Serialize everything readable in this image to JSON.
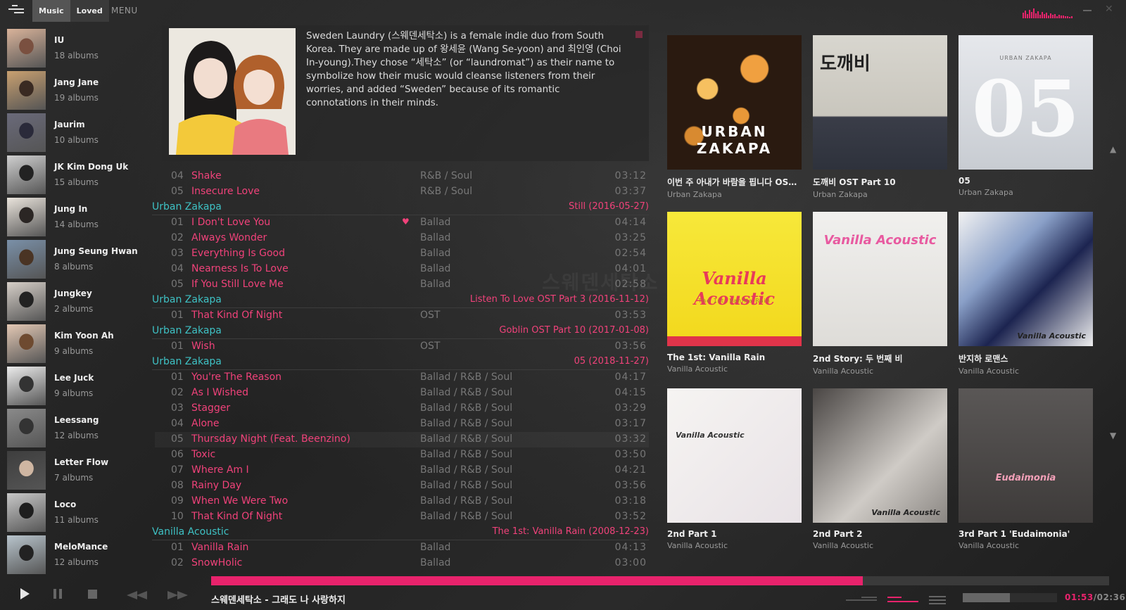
{
  "topbar": {
    "tabs": [
      "Music",
      "Loved"
    ],
    "menu_label": "MENU"
  },
  "artists": [
    {
      "name": "IU",
      "albums": "18 albums"
    },
    {
      "name": "Jang Jane",
      "albums": "19 albums"
    },
    {
      "name": "Jaurim",
      "albums": "10 albums"
    },
    {
      "name": "JK Kim Dong Uk",
      "albums": "15 albums"
    },
    {
      "name": "Jung In",
      "albums": "14 albums"
    },
    {
      "name": "Jung Seung Hwan",
      "albums": "8 albums"
    },
    {
      "name": "Jungkey",
      "albums": "2 albums"
    },
    {
      "name": "Kim Yoon Ah",
      "albums": "9 albums"
    },
    {
      "name": "Lee Juck",
      "albums": "9 albums"
    },
    {
      "name": "Leessang",
      "albums": "12 albums"
    },
    {
      "name": "Letter Flow",
      "albums": "7 albums"
    },
    {
      "name": "Loco",
      "albums": "11 albums"
    },
    {
      "name": "MeloMance",
      "albums": "12 albums"
    }
  ],
  "artist_info": {
    "bio": "Sweden Laundry (스웨덴세탁소) is a female indie duo from South Korea. They are made up of 왕세윤 (Wang Se-yoon) and 최인영 (Choi In-young).They chose “세탁소” (or “laundromat”) as their name to symbolize how their music would cleanse listeners from their worries, and added “Sweden” because of its romantic connotations in their minds."
  },
  "tracklist": {
    "pre_tracks": [
      {
        "no": "04",
        "title": "Shake",
        "genre": "R&B / Soul",
        "duration": "03:12"
      },
      {
        "no": "05",
        "title": "Insecure Love",
        "genre": "R&B / Soul",
        "duration": "03:37"
      }
    ],
    "groups": [
      {
        "artist": "Urban Zakapa",
        "album": "Still (2016-05-27)",
        "tracks": [
          {
            "no": "01",
            "title": "I Don't Love You",
            "genre": "Ballad",
            "duration": "04:14",
            "loved": true
          },
          {
            "no": "02",
            "title": "Always Wonder",
            "genre": "Ballad",
            "duration": "03:25"
          },
          {
            "no": "03",
            "title": "Everything Is Good",
            "genre": "Ballad",
            "duration": "02:54"
          },
          {
            "no": "04",
            "title": "Nearness Is To Love",
            "genre": "Ballad",
            "duration": "04:01"
          },
          {
            "no": "05",
            "title": "If You Still Love Me",
            "genre": "Ballad",
            "duration": "02:58"
          }
        ]
      },
      {
        "artist": "Urban Zakapa",
        "album": "Listen To Love OST Part 3 (2016-11-12)",
        "tracks": [
          {
            "no": "01",
            "title": "That Kind Of Night",
            "genre": "OST",
            "duration": "03:53"
          }
        ]
      },
      {
        "artist": "Urban Zakapa",
        "album": "Goblin OST Part 10 (2017-01-08)",
        "tracks": [
          {
            "no": "01",
            "title": "Wish",
            "genre": "OST",
            "duration": "03:56"
          }
        ]
      },
      {
        "artist": "Urban Zakapa",
        "album": "05 (2018-11-27)",
        "tracks": [
          {
            "no": "01",
            "title": "You're The Reason",
            "genre": "Ballad / R&B / Soul",
            "duration": "04:17"
          },
          {
            "no": "02",
            "title": "As I Wished",
            "genre": "Ballad / R&B / Soul",
            "duration": "04:15"
          },
          {
            "no": "03",
            "title": "Stagger",
            "genre": "Ballad / R&B / Soul",
            "duration": "03:29"
          },
          {
            "no": "04",
            "title": "Alone",
            "genre": "Ballad / R&B / Soul",
            "duration": "03:17"
          },
          {
            "no": "05",
            "title": "Thursday Night (Feat. Beenzino)",
            "genre": "Ballad / R&B / Soul",
            "duration": "03:32",
            "highlight": true
          },
          {
            "no": "06",
            "title": "Toxic",
            "genre": "Ballad / R&B / Soul",
            "duration": "03:50"
          },
          {
            "no": "07",
            "title": "Where Am I",
            "genre": "Ballad / R&B / Soul",
            "duration": "04:21"
          },
          {
            "no": "08",
            "title": "Rainy Day",
            "genre": "Ballad / R&B / Soul",
            "duration": "03:56"
          },
          {
            "no": "09",
            "title": "When We Were Two",
            "genre": "Ballad / R&B / Soul",
            "duration": "03:18"
          },
          {
            "no": "10",
            "title": "That Kind Of Night",
            "genre": "Ballad / R&B / Soul",
            "duration": "03:52"
          }
        ]
      },
      {
        "artist": "Vanilla Acoustic",
        "album": "The 1st: Vanilla Rain (2008-12-23)",
        "tracks": [
          {
            "no": "01",
            "title": "Vanilla Rain",
            "genre": "Ballad",
            "duration": "04:13"
          },
          {
            "no": "02",
            "title": "SnowHolic",
            "genre": "Ballad",
            "duration": "03:00"
          }
        ]
      }
    ]
  },
  "albums": [
    {
      "title": "이번 주 아내가 바람을 핍니다 OST P...",
      "artist": "Urban Zakapa",
      "cover_text": "URBAN ZAKAPA"
    },
    {
      "title": "도깨비 OST Part 10",
      "artist": "Urban Zakapa",
      "cover_text": "도깨비"
    },
    {
      "title": "05",
      "artist": "Urban Zakapa",
      "cover_text": "05",
      "cover_small": "URBAN ZAKAPA"
    },
    {
      "title": "The 1st: Vanilla Rain",
      "artist": "Vanilla Acoustic",
      "cover_text": "Vanilla Acoustic",
      "cover_small": "The 1st: Vanilla Rain"
    },
    {
      "title": "2nd Story: 두 번째 비",
      "artist": "Vanilla Acoustic",
      "cover_text": "Vanilla Acoustic"
    },
    {
      "title": "반지하 로맨스",
      "artist": "Vanilla Acoustic",
      "cover_text": "Vanilla Acoustic"
    },
    {
      "title": "2nd Part 1",
      "artist": "Vanilla Acoustic",
      "cover_text": "Vanilla Acoustic"
    },
    {
      "title": "2nd Part 2",
      "artist": "Vanilla Acoustic",
      "cover_text": "Vanilla Acoustic"
    },
    {
      "title": "3rd Part 1 'Eudaimonia'",
      "artist": "Vanilla Acoustic",
      "cover_text": "Eudaimonia"
    }
  ],
  "player": {
    "now_playing": "스웨덴세탁소 - 그래도 나 사랑하지",
    "current_time": "01:53",
    "total_time": "02:36",
    "progress_fraction": 0.726,
    "volume_fraction": 0.5,
    "controls": [
      "play-icon",
      "pause-icon",
      "stop-icon",
      "previous-icon",
      "next-icon"
    ]
  },
  "colors": {
    "accent": "#e8236c",
    "track_title": "#f0427a",
    "group_artist": "#3ec1c4"
  }
}
